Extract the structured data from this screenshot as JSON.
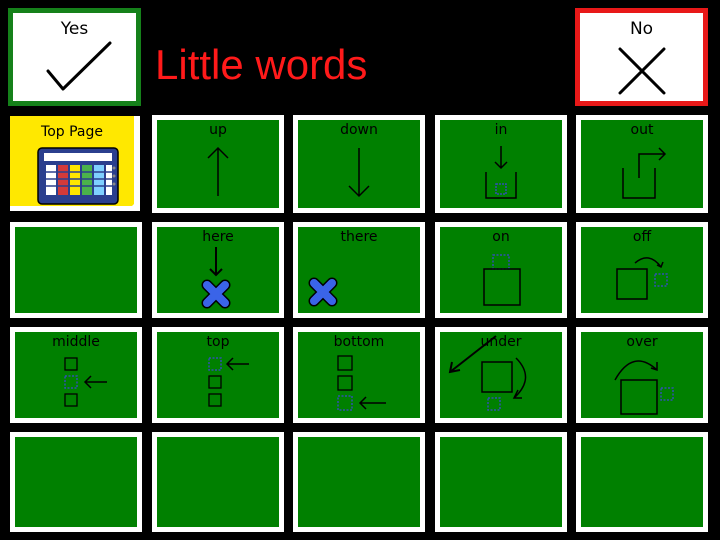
{
  "header": {
    "title": "Little words",
    "yes_label": "Yes",
    "no_label": "No"
  },
  "grid": {
    "top_page_label": "Top Page",
    "rows": [
      [
        "up",
        "down",
        "in",
        "out"
      ],
      [
        "",
        "here",
        "there",
        "on",
        "off"
      ],
      [
        "middle",
        "top",
        "bottom",
        "under",
        "over"
      ],
      [
        "",
        "",
        "",
        "",
        ""
      ]
    ]
  },
  "colors": {
    "background": "#000000",
    "tile_green": "#008000",
    "title_red": "#ff1a1a",
    "yes_border": "#15811a",
    "no_border": "#e81818",
    "top_page_yellow": "#ffe800"
  }
}
